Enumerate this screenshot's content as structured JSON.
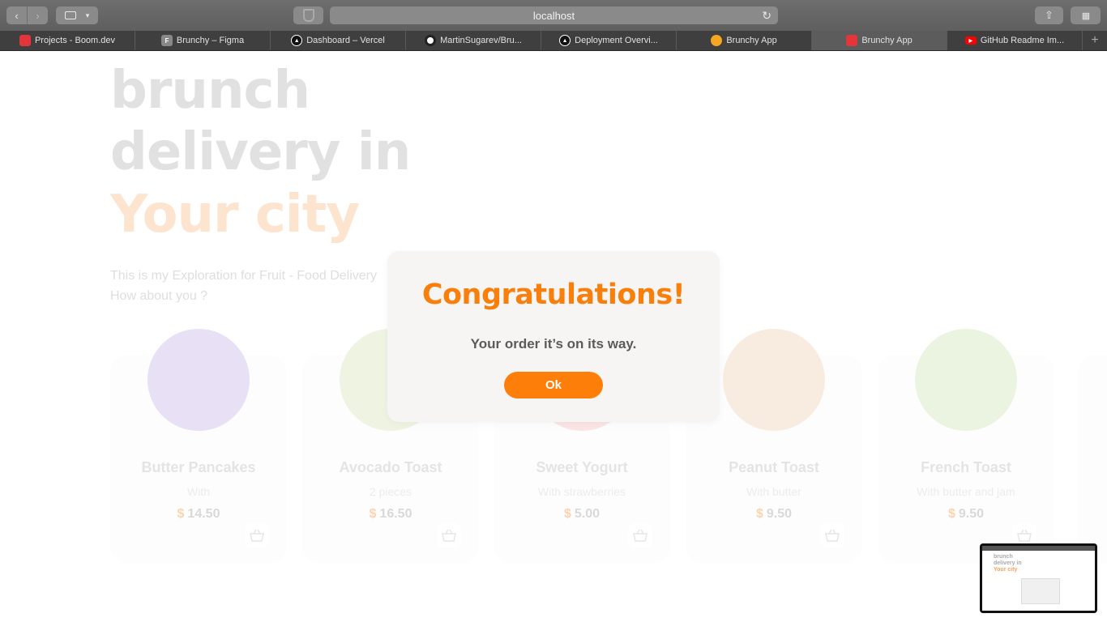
{
  "browser": {
    "url": "localhost",
    "tabs": [
      {
        "label": "Projects - Boom.dev",
        "favicon": "boom",
        "color": "#e4353b",
        "active": false
      },
      {
        "label": "Brunchy – Figma",
        "favicon": "F",
        "color": "#888888",
        "active": false
      },
      {
        "label": "Dashboard – Vercel",
        "favicon": "vercel",
        "color": "#111111",
        "active": false
      },
      {
        "label": "MartinSugarev/Bru...",
        "favicon": "github",
        "color": "#ffffff",
        "active": false
      },
      {
        "label": "Deployment Overvi...",
        "favicon": "vercel",
        "color": "#111111",
        "active": false
      },
      {
        "label": "Brunchy App",
        "favicon": "pancake",
        "color": "#f5a623",
        "active": false
      },
      {
        "label": "Brunchy App",
        "favicon": "boom",
        "color": "#e4353b",
        "active": true
      },
      {
        "label": "GitHub Readme Im...",
        "favicon": "youtube",
        "color": "#ff0000",
        "active": false
      }
    ]
  },
  "hero": {
    "line1": "brunch",
    "line2": "delivery in",
    "line3": "Your city",
    "subtitle": "This is my Exploration for Fruit - Food Delivery How about you ?"
  },
  "products": [
    {
      "name": "Butter Pancakes",
      "sub": "With",
      "currency": "$",
      "price": "14.50",
      "image": "pancakes",
      "color": "#e8e0f5"
    },
    {
      "name": "Avocado Toast",
      "sub": "2 pieces",
      "currency": "$",
      "price": "16.50",
      "image": "avocado-toast",
      "color": "#eef3e2"
    },
    {
      "name": "Sweet Yogurt",
      "sub": "With strawberries",
      "currency": "$",
      "price": "5.00",
      "image": "yogurt",
      "color": "#fbe4e4"
    },
    {
      "name": "Peanut Toast",
      "sub": "With butter",
      "currency": "$",
      "price": "9.50",
      "image": "peanut-toast",
      "color": "#f8ece0"
    },
    {
      "name": "French Toast",
      "sub": "With butter and jam",
      "currency": "$",
      "price": "9.50",
      "image": "french-toast",
      "color": "#eaf4e1"
    }
  ],
  "modal": {
    "title": "Congratulations!",
    "message": "Your order it’s on its way.",
    "button": "Ok"
  },
  "thumbnail": {
    "line1": "brunch",
    "line2": "delivery in",
    "line3": "Your city"
  }
}
